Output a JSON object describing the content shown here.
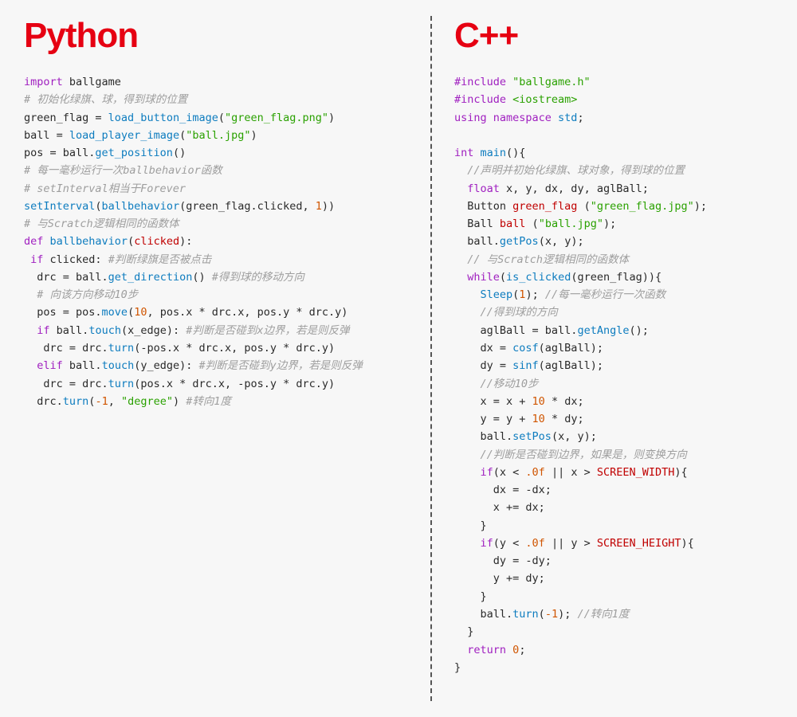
{
  "left": {
    "title": "Python",
    "code_tokens": [
      [
        [
          "kw",
          "import"
        ],
        [
          "id",
          " ballgame"
        ]
      ],
      [
        [
          "cmt",
          "# 初始化绿旗、球，得到球的位置"
        ]
      ],
      [
        [
          "id",
          "green_flag = "
        ],
        [
          "fn",
          "load_button_image"
        ],
        [
          "id",
          "("
        ],
        [
          "str",
          "\"green_flag.png\""
        ],
        [
          "id",
          ")"
        ]
      ],
      [
        [
          "id",
          "ball = "
        ],
        [
          "fn",
          "load_player_image"
        ],
        [
          "id",
          "("
        ],
        [
          "str",
          "\"ball.jpg\""
        ],
        [
          "id",
          ")"
        ]
      ],
      [
        [
          "id",
          "pos = ball."
        ],
        [
          "fn",
          "get_position"
        ],
        [
          "id",
          "()"
        ]
      ],
      [
        [
          "cmt",
          "# 每一毫秒运行一次ballbehavior函数"
        ]
      ],
      [
        [
          "cmt",
          "# setInterval相当于Forever"
        ]
      ],
      [
        [
          "fn",
          "setInterval"
        ],
        [
          "id",
          "("
        ],
        [
          "fn",
          "ballbehavior"
        ],
        [
          "id",
          "(green_flag.clicked, "
        ],
        [
          "num",
          "1"
        ],
        [
          "id",
          "))"
        ]
      ],
      [
        [
          "cmt",
          "# 与Scratch逻辑相同的函数体"
        ]
      ],
      [
        [
          "kw",
          "def "
        ],
        [
          "fn",
          "ballbehavior"
        ],
        [
          "id",
          "("
        ],
        [
          "cls",
          "clicked"
        ],
        [
          "id",
          "):"
        ]
      ],
      [
        [
          "id",
          " "
        ],
        [
          "kw",
          "if"
        ],
        [
          "id",
          " clicked: "
        ],
        [
          "cmt",
          "#判断绿旗是否被点击"
        ]
      ],
      [
        [
          "id",
          "  drc = ball."
        ],
        [
          "fn",
          "get_direction"
        ],
        [
          "id",
          "() "
        ],
        [
          "cmt",
          "#得到球的移动方向"
        ]
      ],
      [
        [
          "id",
          "  "
        ],
        [
          "cmt",
          "# 向该方向移动10步"
        ]
      ],
      [
        [
          "id",
          "  pos = pos."
        ],
        [
          "fn",
          "move"
        ],
        [
          "id",
          "("
        ],
        [
          "num",
          "10"
        ],
        [
          "id",
          ", pos.x * drc.x, pos.y * drc.y)"
        ]
      ],
      [
        [
          "id",
          "  "
        ],
        [
          "kw",
          "if"
        ],
        [
          "id",
          " ball."
        ],
        [
          "fn",
          "touch"
        ],
        [
          "id",
          "(x_edge): "
        ],
        [
          "cmt",
          "#判断是否碰到x边界，若是则反弹"
        ]
      ],
      [
        [
          "id",
          "   drc = drc."
        ],
        [
          "fn",
          "turn"
        ],
        [
          "id",
          "(-pos.x * drc.x, pos.y * drc.y)"
        ]
      ],
      [
        [
          "id",
          "  "
        ],
        [
          "kw",
          "elif"
        ],
        [
          "id",
          " ball."
        ],
        [
          "fn",
          "touch"
        ],
        [
          "id",
          "(y_edge): "
        ],
        [
          "cmt",
          "#判断是否碰到y边界，若是则反弹"
        ]
      ],
      [
        [
          "id",
          "   drc = drc."
        ],
        [
          "fn",
          "turn"
        ],
        [
          "id",
          "(pos.x * drc.x, -pos.y * drc.y)"
        ]
      ],
      [
        [
          "id",
          "  drc."
        ],
        [
          "fn",
          "turn"
        ],
        [
          "id",
          "("
        ],
        [
          "num",
          "-1"
        ],
        [
          "id",
          ", "
        ],
        [
          "str",
          "\"degree\""
        ],
        [
          "id",
          ") "
        ],
        [
          "cmt",
          "#转向1度"
        ]
      ]
    ]
  },
  "right": {
    "title": "C++",
    "code_tokens": [
      [
        [
          "pre",
          "#include "
        ],
        [
          "str",
          "\"ballgame.h\""
        ]
      ],
      [
        [
          "pre",
          "#include "
        ],
        [
          "str",
          "<iostream>"
        ]
      ],
      [
        [
          "kw",
          "using namespace "
        ],
        [
          "fn",
          "std"
        ],
        [
          "id",
          ";"
        ]
      ],
      [
        [
          "id",
          ""
        ]
      ],
      [
        [
          "type",
          "int "
        ],
        [
          "fn",
          "main"
        ],
        [
          "id",
          "(){"
        ]
      ],
      [
        [
          "id",
          "  "
        ],
        [
          "cmt",
          "//声明并初始化绿旗、球对象，得到球的位置"
        ]
      ],
      [
        [
          "id",
          "  "
        ],
        [
          "type",
          "float"
        ],
        [
          "id",
          " x, y, dx, dy, aglBall;"
        ]
      ],
      [
        [
          "id",
          "  Button "
        ],
        [
          "cls",
          "green_flag"
        ],
        [
          "id",
          " ("
        ],
        [
          "str",
          "\"green_flag.jpg\""
        ],
        [
          "id",
          ");"
        ]
      ],
      [
        [
          "id",
          "  Ball "
        ],
        [
          "cls",
          "ball"
        ],
        [
          "id",
          " ("
        ],
        [
          "str",
          "\"ball.jpg\""
        ],
        [
          "id",
          ");"
        ]
      ],
      [
        [
          "id",
          "  ball."
        ],
        [
          "fn",
          "getPos"
        ],
        [
          "id",
          "(x, y);"
        ]
      ],
      [
        [
          "id",
          "  "
        ],
        [
          "cmt",
          "// 与Scratch逻辑相同的函数体"
        ]
      ],
      [
        [
          "id",
          "  "
        ],
        [
          "kw",
          "while"
        ],
        [
          "id",
          "("
        ],
        [
          "fn",
          "is_clicked"
        ],
        [
          "id",
          "(green_flag)){"
        ]
      ],
      [
        [
          "id",
          "    "
        ],
        [
          "fn",
          "Sleep"
        ],
        [
          "id",
          "("
        ],
        [
          "num",
          "1"
        ],
        [
          "id",
          "); "
        ],
        [
          "cmt",
          "//每一毫秒运行一次函数"
        ]
      ],
      [
        [
          "id",
          "    "
        ],
        [
          "cmt",
          "//得到球的方向"
        ]
      ],
      [
        [
          "id",
          "    aglBall = ball."
        ],
        [
          "fn",
          "getAngle"
        ],
        [
          "id",
          "();"
        ]
      ],
      [
        [
          "id",
          "    dx = "
        ],
        [
          "fn",
          "cosf"
        ],
        [
          "id",
          "(aglBall);"
        ]
      ],
      [
        [
          "id",
          "    dy = "
        ],
        [
          "fn",
          "sinf"
        ],
        [
          "id",
          "(aglBall);"
        ]
      ],
      [
        [
          "id",
          "    "
        ],
        [
          "cmt",
          "//移动10步"
        ]
      ],
      [
        [
          "id",
          "    x = x + "
        ],
        [
          "num",
          "10"
        ],
        [
          "id",
          " * dx;"
        ]
      ],
      [
        [
          "id",
          "    y = y + "
        ],
        [
          "num",
          "10"
        ],
        [
          "id",
          " * dy;"
        ]
      ],
      [
        [
          "id",
          "    ball."
        ],
        [
          "fn",
          "setPos"
        ],
        [
          "id",
          "(x, y);"
        ]
      ],
      [
        [
          "id",
          "    "
        ],
        [
          "cmt",
          "//判断是否碰到边界，如果是，则变换方向"
        ]
      ],
      [
        [
          "id",
          "    "
        ],
        [
          "kw",
          "if"
        ],
        [
          "id",
          "(x < "
        ],
        [
          "num",
          ".0f"
        ],
        [
          "id",
          " || x > "
        ],
        [
          "macro",
          "SCREEN_WIDTH"
        ],
        [
          "id",
          "){"
        ]
      ],
      [
        [
          "id",
          "      dx = -dx;"
        ]
      ],
      [
        [
          "id",
          "      x += dx;"
        ]
      ],
      [
        [
          "id",
          "    }"
        ]
      ],
      [
        [
          "id",
          "    "
        ],
        [
          "kw",
          "if"
        ],
        [
          "id",
          "(y < "
        ],
        [
          "num",
          ".0f"
        ],
        [
          "id",
          " || y > "
        ],
        [
          "macro",
          "SCREEN_HEIGHT"
        ],
        [
          "id",
          "){"
        ]
      ],
      [
        [
          "id",
          "      dy = -dy;"
        ]
      ],
      [
        [
          "id",
          "      y += dy;"
        ]
      ],
      [
        [
          "id",
          "    }"
        ]
      ],
      [
        [
          "id",
          "    ball."
        ],
        [
          "fn",
          "turn"
        ],
        [
          "id",
          "("
        ],
        [
          "num",
          "-1"
        ],
        [
          "id",
          "); "
        ],
        [
          "cmt",
          "//转向1度"
        ]
      ],
      [
        [
          "id",
          "  }"
        ]
      ],
      [
        [
          "id",
          "  "
        ],
        [
          "kw",
          "return "
        ],
        [
          "num",
          "0"
        ],
        [
          "id",
          ";"
        ]
      ],
      [
        [
          "id",
          "}"
        ]
      ]
    ]
  }
}
